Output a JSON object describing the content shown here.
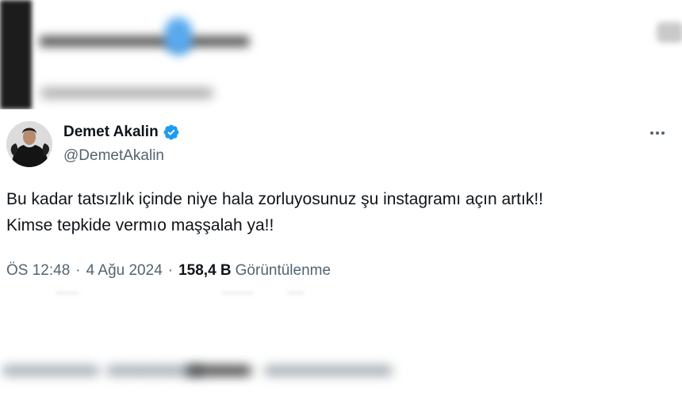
{
  "author": {
    "display_name": "Demet Akalin",
    "username": "@DemetAkalin",
    "verified": true
  },
  "tweet": {
    "lines": [
      "Bu kadar tatsızlık içinde niye hala zorluyosunuz şu instagramı açın artık!!",
      "Kimse tepkide vermıo maşşalah ya!!"
    ]
  },
  "meta": {
    "time": "ÖS 12:48",
    "separator": "·",
    "date": "4 Ağu 2024",
    "views_count": "158,4 B",
    "views_label": "Görüntülenme"
  },
  "colors": {
    "text_primary": "#0f1419",
    "text_secondary": "#536471",
    "verified_blue": "#1d9bf0"
  },
  "icons": {
    "verified": "verified-badge-icon",
    "more": "more-horizontal-icon"
  }
}
